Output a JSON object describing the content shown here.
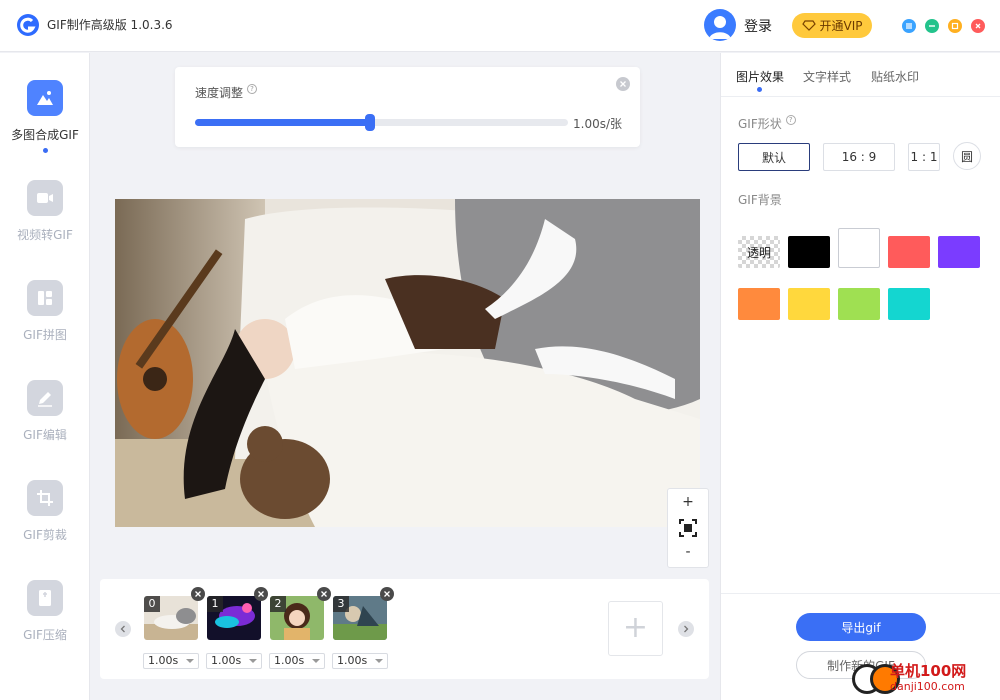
{
  "app": {
    "title": "GIF制作高级版 1.0.3.6",
    "logo_icon": "app-logo-icon"
  },
  "header": {
    "login_label": "登录",
    "vip_label": "开通VIP",
    "vip_color": "#ffc93c"
  },
  "window_controls": [
    {
      "name": "menu",
      "color": "#3aa3ff"
    },
    {
      "name": "minimize",
      "color": "#23c38c"
    },
    {
      "name": "maximize",
      "color": "#ffb020"
    },
    {
      "name": "close",
      "color": "#ff5b5b"
    }
  ],
  "sidebar": {
    "items": [
      {
        "label": "多图合成GIF",
        "icon": "images-icon",
        "active": true
      },
      {
        "label": "视频转GIF",
        "icon": "video-icon",
        "active": false
      },
      {
        "label": "GIF拼图",
        "icon": "puzzle-icon",
        "active": false
      },
      {
        "label": "GIF编辑",
        "icon": "edit-icon",
        "active": false
      },
      {
        "label": "GIF剪裁",
        "icon": "crop-icon",
        "active": false
      },
      {
        "label": "GIF压缩",
        "icon": "compress-icon",
        "active": false
      }
    ]
  },
  "speed": {
    "label": "速度调整",
    "value_text": "1.00s/张",
    "level": 0.47
  },
  "zoom": {
    "in": "+",
    "out": "-"
  },
  "frames": [
    {
      "index": "0",
      "duration": "1.00s"
    },
    {
      "index": "1",
      "duration": "1.00s"
    },
    {
      "index": "2",
      "duration": "1.00s"
    },
    {
      "index": "3",
      "duration": "1.00s"
    }
  ],
  "add_frame_label": "+",
  "right_panel": {
    "tabs": [
      {
        "label": "图片效果",
        "active": true
      },
      {
        "label": "文字样式",
        "active": false
      },
      {
        "label": "贴纸水印",
        "active": false
      }
    ],
    "shape_label": "GIF形状",
    "shapes": [
      {
        "label": "默认",
        "selected": true
      },
      {
        "label": "16 : 9",
        "selected": false
      },
      {
        "label": "1 : 1",
        "selected": false
      },
      {
        "label": "圆",
        "selected": false
      }
    ],
    "background_label": "GIF背景",
    "transparent_label": "透明",
    "colors": [
      "#000000",
      "#ffffff",
      "#ff5b5b",
      "#7b3cff",
      "#ff8a3d",
      "#ffd83d",
      "#9fe052",
      "#14d6d0"
    ],
    "export_label": "导出gif",
    "make_new_label": "制作新的GIF"
  },
  "watermark": {
    "title": "单机100网",
    "url": "danji100.com"
  }
}
